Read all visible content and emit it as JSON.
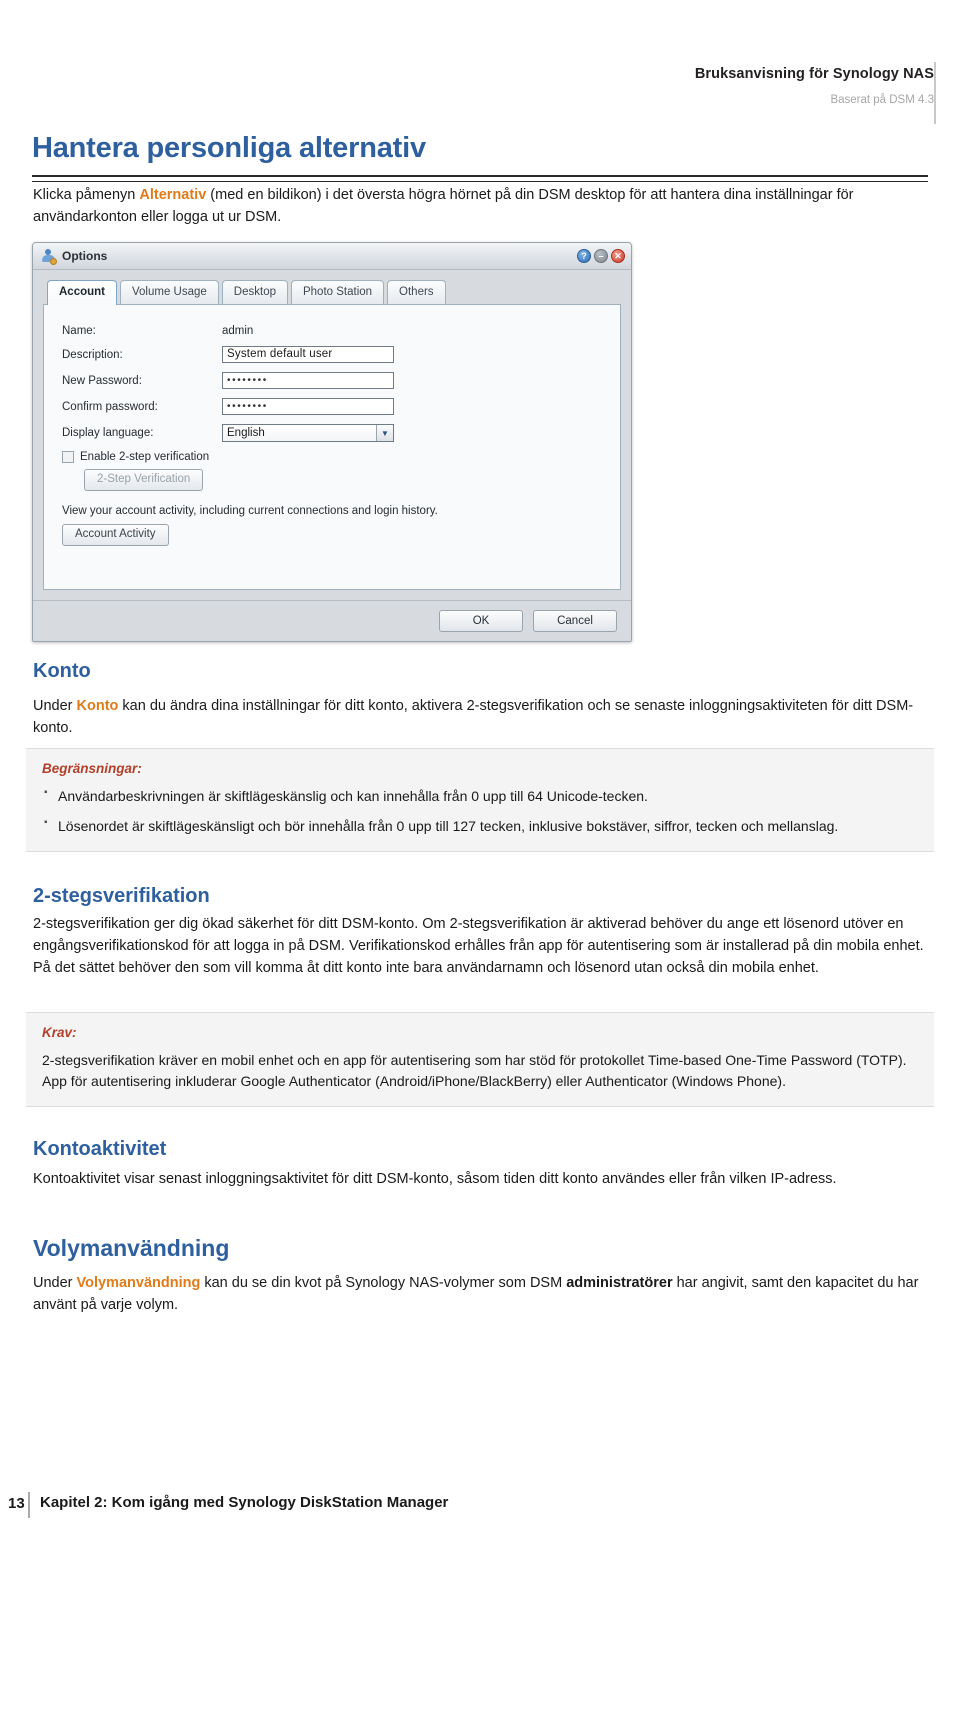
{
  "header": {
    "manual_title": "Bruksanvisning för Synology NAS",
    "based_on": "Baserat på DSM 4.3"
  },
  "page_title": "Hantera personliga alternativ",
  "intro": {
    "before": "Klicka påmenyn ",
    "link": "Alternativ",
    "after": " (med en bildikon) i det översta högra hörnet på din DSM desktop för att hantera dina inställningar för användarkonton eller logga ut ur DSM."
  },
  "dialog": {
    "title": "Options",
    "window_buttons": {
      "help": "?",
      "minimize": "–",
      "close": "✕"
    },
    "tabs": [
      {
        "label": "Account",
        "active": true
      },
      {
        "label": "Volume Usage",
        "active": false
      },
      {
        "label": "Desktop",
        "active": false
      },
      {
        "label": "Photo Station",
        "active": false
      },
      {
        "label": "Others",
        "active": false
      }
    ],
    "fields": {
      "name_label": "Name:",
      "name_value": "admin",
      "description_label": "Description:",
      "description_value": "System default user",
      "new_password_label": "New Password:",
      "new_password_value": "••••••••",
      "confirm_password_label": "Confirm password:",
      "confirm_password_value": "••••••••",
      "display_language_label": "Display language:",
      "display_language_value": "English",
      "dropdown_arrow": "▼"
    },
    "two_step": {
      "checkbox_label": "Enable 2-step verification",
      "checked": false,
      "button_label": "2-Step Verification"
    },
    "activity": {
      "note": "View your account activity, including current connections and login history.",
      "button_label": "Account Activity"
    },
    "footer": {
      "ok": "OK",
      "cancel": "Cancel"
    }
  },
  "sections": {
    "konto": {
      "heading": "Konto",
      "para_before": "Under ",
      "para_link": "Konto",
      "para_after": " kan du ändra dina inställningar för ditt konto, aktivera 2-stegsverifikation och se senaste inloggningsaktiviteten för ditt DSM-konto.",
      "note_title": "Begränsningar:",
      "note_items": [
        "Användarbeskrivningen är skiftlägeskänslig och kan innehålla från 0 upp till 64 Unicode-tecken.",
        "Lösenordet är skiftlägeskänsligt och bör innehålla från 0 upp till 127 tecken, inklusive bokstäver, siffror, tecken och mellanslag."
      ]
    },
    "tva_stegs": {
      "heading": "2-stegsverifikation",
      "para": "2-stegsverifikation ger dig ökad säkerhet för ditt DSM-konto. Om 2-stegsverifikation är aktiverad behöver du ange ett lösenord utöver en engångsverifikationskod för att logga in på DSM. Verifikationskod erhålles från app för autentisering som är installerad på din mobila enhet. På det sättet behöver den som vill komma åt ditt konto inte bara användarnamn och lösenord utan också din mobila enhet.",
      "note_title": "Krav:",
      "note_para": "2-stegsverifikation kräver en mobil enhet och en app för autentisering som har stöd för protokollet Time-based One-Time Password (TOTP). App för autentisering inkluderar Google Authenticator (Android/iPhone/BlackBerry) eller Authenticator (Windows Phone)."
    },
    "kontoaktivitet": {
      "heading": "Kontoaktivitet",
      "para": "Kontoaktivitet visar senast inloggningsaktivitet för ditt DSM-konto, såsom tiden ditt konto användes eller från vilken IP-adress."
    },
    "volymanvandning": {
      "heading": "Volymanvändning",
      "para_before": "Under ",
      "para_link": "Volymanvändning",
      "para_mid": " kan du se din kvot på Synology NAS-volymer som DSM ",
      "para_bold": "administratörer",
      "para_after": " har angivit, samt den kapacitet du har använt på varje volym."
    }
  },
  "footer": {
    "page_number": "13",
    "text": "Kapitel 2: Kom igång med Synology DiskStation Manager"
  },
  "colors": {
    "heading_blue": "#2e5f9e",
    "accent_orange": "#e07b18",
    "note_red": "#b1402b",
    "note_bg": "#f4f4f4"
  }
}
